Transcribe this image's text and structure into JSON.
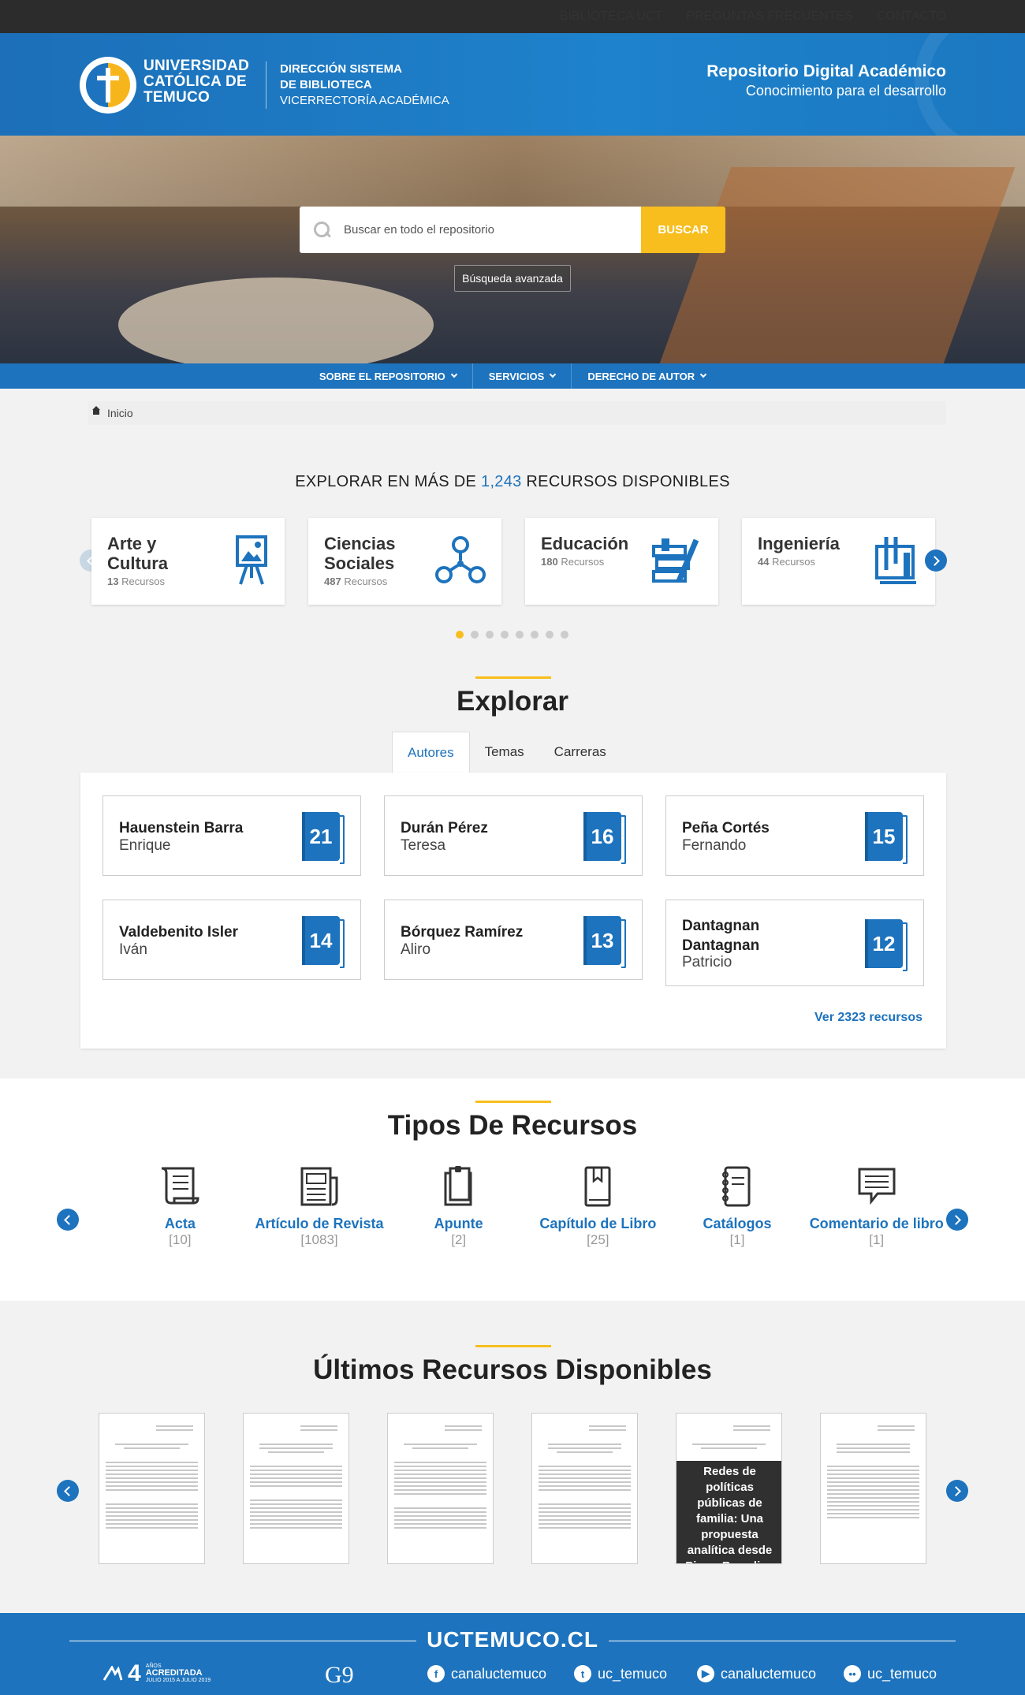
{
  "topbar": {
    "links": [
      "BIBLIOTECA UCT",
      "PREGUNTAS FRECUENTES",
      "CONTACTO"
    ]
  },
  "header": {
    "university": [
      "UNIVERSIDAD",
      "CATÓLICA DE",
      "TEMUCO"
    ],
    "dept": {
      "line1": "DIRECCIÓN SISTEMA",
      "line2": "DE BIBLIOTECA",
      "line3": "VICERRECTORÍA ACADÉMICA"
    },
    "repo_title": "Repositorio Digital Académico",
    "repo_subtitle": "Conocimiento para el desarrollo"
  },
  "search": {
    "placeholder": "Buscar en todo el repositorio",
    "button": "BUSCAR",
    "advanced": "Búsqueda avanzada"
  },
  "nav": {
    "items": [
      "SOBRE EL REPOSITORIO",
      "SERVICIOS",
      "DERECHO DE AUTOR"
    ]
  },
  "breadcrumb": {
    "home": "Inicio"
  },
  "explore_count": {
    "prefix": "EXPLORAR EN MÁS DE ",
    "count": "1,243",
    "suffix": " RECURSOS DISPONIBLES"
  },
  "categories": [
    {
      "name": "Arte y Cultura",
      "count": "13",
      "unit": "Recursos",
      "icon": "easel-icon"
    },
    {
      "name": "Ciencias Sociales",
      "count": "487",
      "unit": "Recursos",
      "icon": "network-icon"
    },
    {
      "name": "Educación",
      "count": "180",
      "unit": "Recursos",
      "icon": "books-pen-icon"
    },
    {
      "name": "Ingeniería",
      "count": "44",
      "unit": "Recursos",
      "icon": "blueprint-icon"
    }
  ],
  "explorar": {
    "title": "Explorar",
    "tabs": [
      "Autores",
      "Temas",
      "Carreras"
    ],
    "active_tab": "Autores",
    "authors": [
      {
        "last": "Hauenstein Barra",
        "first": "Enrique",
        "count": "21"
      },
      {
        "last": "Durán Pérez",
        "first": "Teresa",
        "count": "16"
      },
      {
        "last": "Peña Cortés",
        "first": "Fernando",
        "count": "15"
      },
      {
        "last": "Valdebenito Isler",
        "first": "Iván",
        "count": "14"
      },
      {
        "last": "Bórquez Ramírez",
        "first": "Aliro",
        "count": "13"
      },
      {
        "last": "Dantagnan Dantagnan",
        "first": "Patricio",
        "count": "12"
      }
    ],
    "see_all": "Ver 2323 recursos"
  },
  "tipos": {
    "title": "Tipos De Recursos",
    "items": [
      {
        "label": "Acta",
        "count": "[10]",
        "icon": "scroll-icon"
      },
      {
        "label": "Artículo de Revista",
        "count": "[1083]",
        "icon": "newspaper-icon"
      },
      {
        "label": "Apunte",
        "count": "[2]",
        "icon": "clipboard-icon"
      },
      {
        "label": "Capítulo de Libro",
        "count": "[25]",
        "icon": "bookmark-book-icon"
      },
      {
        "label": "Catálogos",
        "count": "[1]",
        "icon": "notebook-icon"
      },
      {
        "label": "Comentario de libro",
        "count": "[1]",
        "icon": "comment-icon"
      }
    ]
  },
  "latest": {
    "title": "Últimos Recursos Disponibles",
    "hover_title": "Redes de políticas públicas de familia: Una propuesta analítica desde Pierre Bourdieu"
  },
  "footer": {
    "brand": "UCTEMUCO.CL",
    "accreditation": {
      "years": "4",
      "label": "AÑOS",
      "status": "ACREDITADA",
      "period": "JULIO 2015 A JULIO 2019"
    },
    "g9": "G9",
    "social": [
      {
        "icon": "facebook-icon",
        "glyph": "f",
        "handle": "canaluctemuco"
      },
      {
        "icon": "twitter-icon",
        "glyph": "t",
        "handle": "uc_temuco"
      },
      {
        "icon": "youtube-icon",
        "glyph": "▶",
        "handle": "canaluctemuco"
      },
      {
        "icon": "flickr-icon",
        "glyph": "••",
        "handle": "uc_temuco"
      }
    ]
  },
  "colors": {
    "primary": "#1d73bd",
    "accent": "#f7be1d",
    "topbar": "#2c2c2c"
  }
}
